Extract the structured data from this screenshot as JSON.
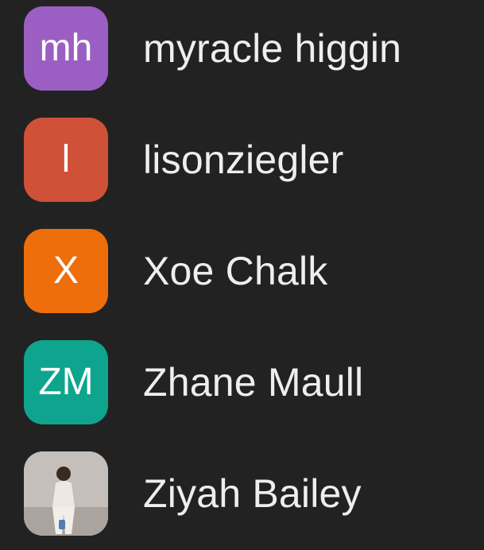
{
  "participants": [
    {
      "initials": "mh",
      "name": "myracle higgin",
      "color": "#9b5fc3"
    },
    {
      "initials": "l",
      "name": "lisonziegler",
      "color": "#cf5138"
    },
    {
      "initials": "X",
      "name": "Xoe Chalk",
      "color": "#ee6e0c"
    },
    {
      "initials": "ZM",
      "name": "Zhane Maull",
      "color": "#0fa48e"
    },
    {
      "initials": "",
      "name": "Ziyah Bailey",
      "color": "#b9b3ae",
      "avatar_icon": "photo-avatar"
    }
  ]
}
